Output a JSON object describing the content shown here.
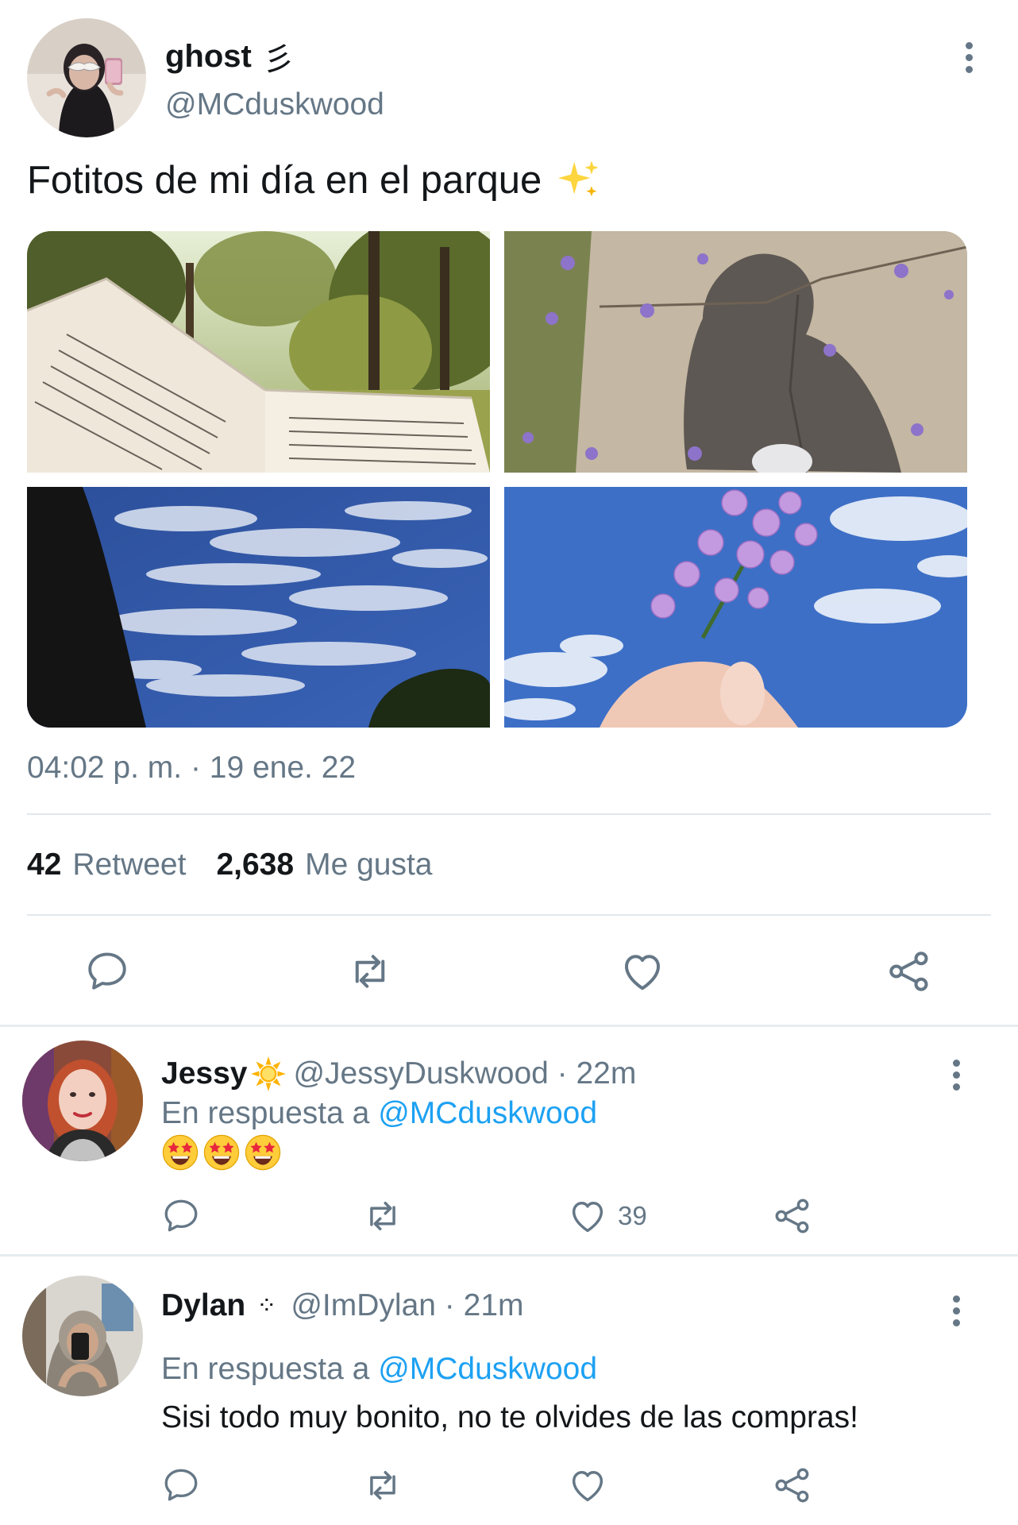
{
  "main_tweet": {
    "name": "ghost",
    "name_decoration": "彡",
    "handle": "@MCduskwood",
    "text": "Fotitos de mi día en el parque",
    "text_emoji": "sparkles-emoji",
    "photos": [
      "book-in-park-photo",
      "shadow-on-stone-photo",
      "cloudy-sky-photo",
      "purple-flowers-photo"
    ],
    "timestamp": "04:02 p. m. · 19 ene. 22",
    "stats": {
      "retweets_count": "42",
      "retweets_label": "Retweet",
      "likes_count": "2,638",
      "likes_label": "Me gusta"
    },
    "actions": [
      "reply-icon",
      "retweet-icon",
      "like-icon",
      "share-icon"
    ]
  },
  "replies": [
    {
      "name": "Jessy",
      "name_emoji": "sun-emoji",
      "handle_time": "@JessyDuskwood · 22m",
      "reply_prefix": "En respuesta a",
      "reply_mention": "@MCduskwood",
      "content_emojis": [
        "star-struck-emoji",
        "star-struck-emoji",
        "star-struck-emoji"
      ],
      "like_count": "39"
    },
    {
      "name": "Dylan",
      "name_decoration": "⁘",
      "handle_time": "@ImDylan · 21m",
      "reply_prefix": "En respuesta a",
      "reply_mention": "@MCduskwood",
      "text": "Sisi todo muy bonito, no te olvides de las compras!"
    }
  ],
  "colors": {
    "text": "#14171a",
    "secondary": "#657786",
    "mention": "#1da1f2",
    "divider": "#e1e8ed"
  }
}
